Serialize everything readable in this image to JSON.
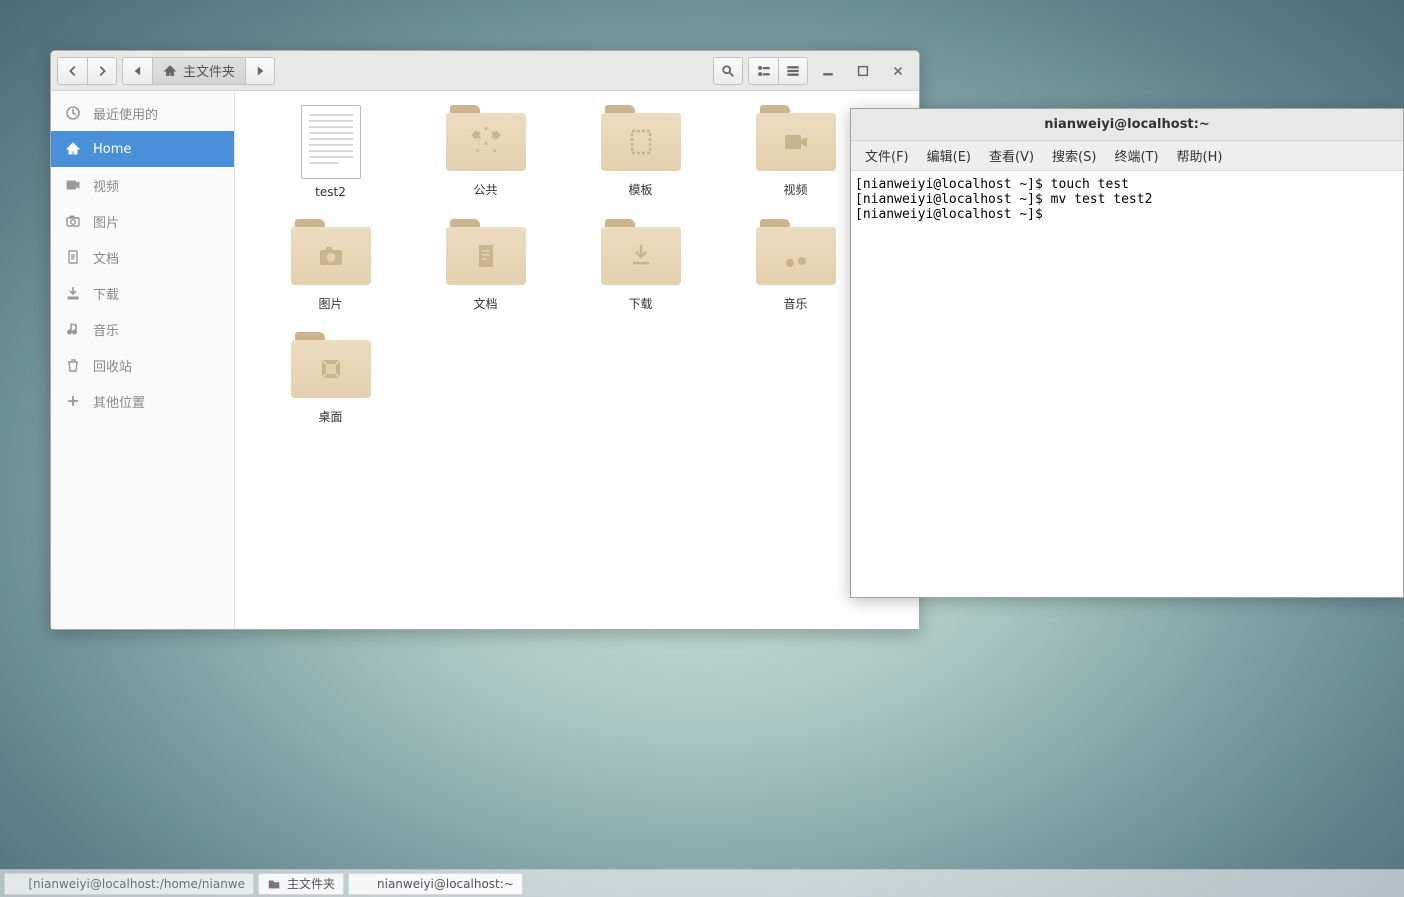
{
  "file_manager": {
    "path_label": "主文件夹",
    "sidebar": [
      {
        "icon": "clock",
        "label": "最近使用的"
      },
      {
        "icon": "home",
        "label": "Home",
        "active": true
      },
      {
        "icon": "video",
        "label": "视频"
      },
      {
        "icon": "camera",
        "label": "图片"
      },
      {
        "icon": "doc",
        "label": "文档"
      },
      {
        "icon": "download",
        "label": "下载"
      },
      {
        "icon": "music",
        "label": "音乐"
      },
      {
        "icon": "trash",
        "label": "回收站"
      },
      {
        "icon": "plus",
        "label": "其他位置"
      }
    ],
    "items": [
      {
        "type": "document",
        "glyph": "",
        "name": "test2"
      },
      {
        "type": "folder",
        "glyph": "expand",
        "name": "公共"
      },
      {
        "type": "folder",
        "glyph": "template",
        "name": "模板"
      },
      {
        "type": "folder",
        "glyph": "video",
        "name": "视频"
      },
      {
        "type": "folder",
        "glyph": "camera",
        "name": "图片"
      },
      {
        "type": "folder",
        "glyph": "doc",
        "name": "文档"
      },
      {
        "type": "folder",
        "glyph": "download",
        "name": "下载"
      },
      {
        "type": "folder",
        "glyph": "music",
        "name": "音乐"
      },
      {
        "type": "folder",
        "glyph": "desktop",
        "name": "桌面"
      }
    ]
  },
  "terminal": {
    "title": "nianweiyi@localhost:~",
    "menu": [
      "文件(F)",
      "编辑(E)",
      "查看(V)",
      "搜索(S)",
      "终端(T)",
      "帮助(H)"
    ],
    "lines": [
      "[nianweiyi@localhost ~]$ touch test",
      "[nianweiyi@localhost ~]$ mv test test2",
      "[nianweiyi@localhost ~]$ "
    ]
  },
  "taskbar": [
    {
      "icon": "term",
      "label": "[nianweiyi@localhost:/home/nianwe"
    },
    {
      "icon": "folder",
      "label": "主文件夹"
    },
    {
      "icon": "term",
      "label": "nianweiyi@localhost:~"
    }
  ]
}
